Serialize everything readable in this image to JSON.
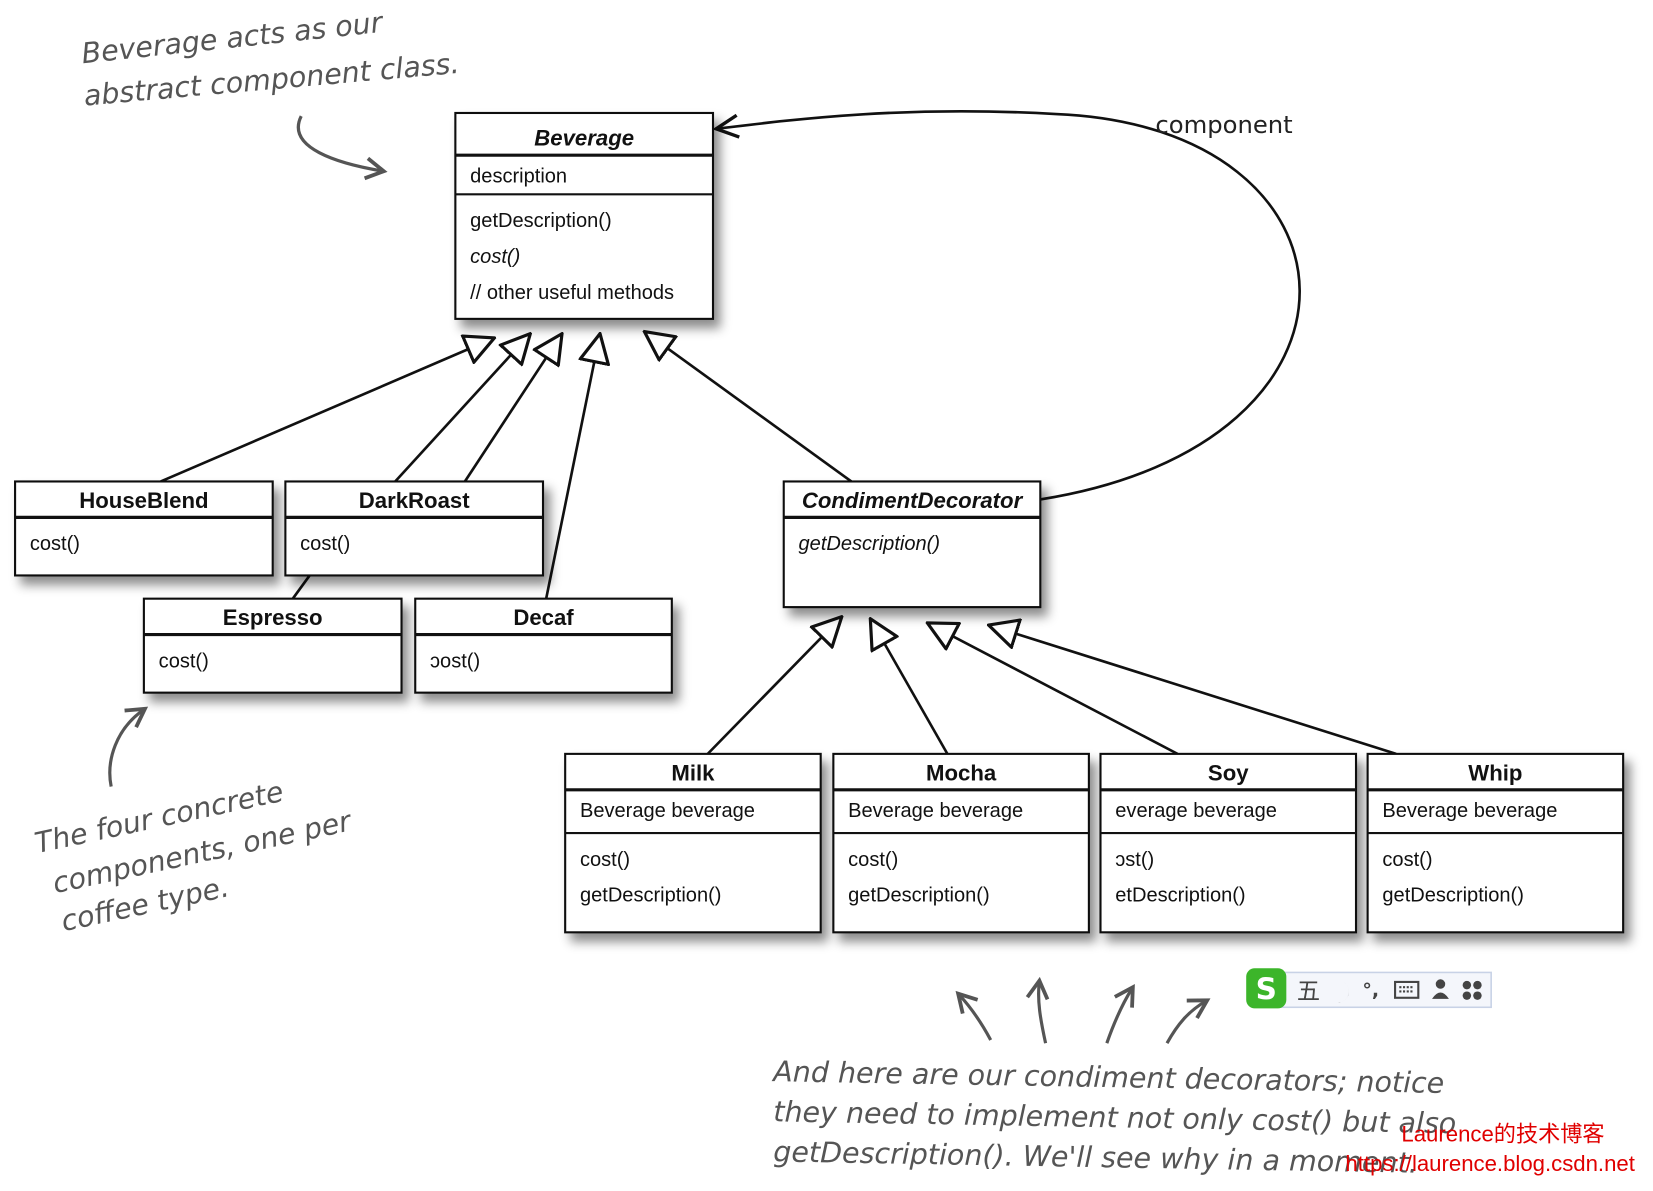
{
  "classes": [
    {
      "id": "beverage",
      "name": "Beverage",
      "abstract": true,
      "attributes": [
        "description"
      ],
      "methods": [
        {
          "text": "getDescription()",
          "italic": false
        },
        {
          "text": "cost()",
          "italic": true
        },
        {
          "text": "// other useful methods",
          "italic": false
        }
      ]
    },
    {
      "id": "houseblend",
      "name": "HouseBlend",
      "abstract": false,
      "methods": [
        {
          "text": "cost()"
        }
      ]
    },
    {
      "id": "darkroast",
      "name": "DarkRoast",
      "abstract": false,
      "methods": [
        {
          "text": "cost()"
        }
      ]
    },
    {
      "id": "espresso",
      "name": "Espresso",
      "abstract": false,
      "methods": [
        {
          "text": "cost()"
        }
      ]
    },
    {
      "id": "decaf",
      "name": "Decaf",
      "abstract": false,
      "methods": [
        {
          "text": "ɔost()"
        }
      ]
    },
    {
      "id": "condimentdecorator",
      "name": "CondimentDecorator",
      "abstract": true,
      "methods": [
        {
          "text": "getDescription()",
          "italic": true
        }
      ]
    },
    {
      "id": "milk",
      "name": "Milk",
      "abstract": false,
      "attributes": [
        "Beverage beverage"
      ],
      "methods": [
        {
          "text": "cost()"
        },
        {
          "text": "getDescription()"
        }
      ]
    },
    {
      "id": "mocha",
      "name": "Mocha",
      "abstract": false,
      "attributes": [
        "Beverage beverage"
      ],
      "methods": [
        {
          "text": "cost()"
        },
        {
          "text": "getDescription()"
        }
      ]
    },
    {
      "id": "soy",
      "name": "Soy",
      "abstract": false,
      "attributes": [
        "everage beverage"
      ],
      "methods": [
        {
          "text": "ɔst()"
        },
        {
          "text": "etDescription()"
        }
      ]
    },
    {
      "id": "whip",
      "name": "Whip",
      "abstract": false,
      "attributes": [
        "Beverage beverage"
      ],
      "methods": [
        {
          "text": "cost()"
        },
        {
          "text": "getDescription()"
        }
      ]
    }
  ],
  "relations": {
    "component_label": "component"
  },
  "annotations": {
    "beverage_note": [
      "Beverage acts as our",
      "abstract component class."
    ],
    "concrete_note": [
      "The four concrete",
      "components, one per",
      "coffee type."
    ],
    "decorator_note": [
      "And here are our condiment decorators; notice",
      "they need to implement not only cost() but also",
      "getDescription(). We'll see why in a moment."
    ]
  },
  "ime_toolbar": {
    "logo": "S",
    "items": [
      "五",
      "moon-icon",
      "°,",
      "keyboard-icon",
      "user-icon",
      "grid-icon"
    ]
  },
  "watermark": {
    "line1": "Laurence的技术博客",
    "line2": "https://laurence.blog.csdn.net"
  },
  "colors": {
    "ime_green": "#3cb52a",
    "watermark": "#e00000",
    "annotation": "#555555"
  }
}
